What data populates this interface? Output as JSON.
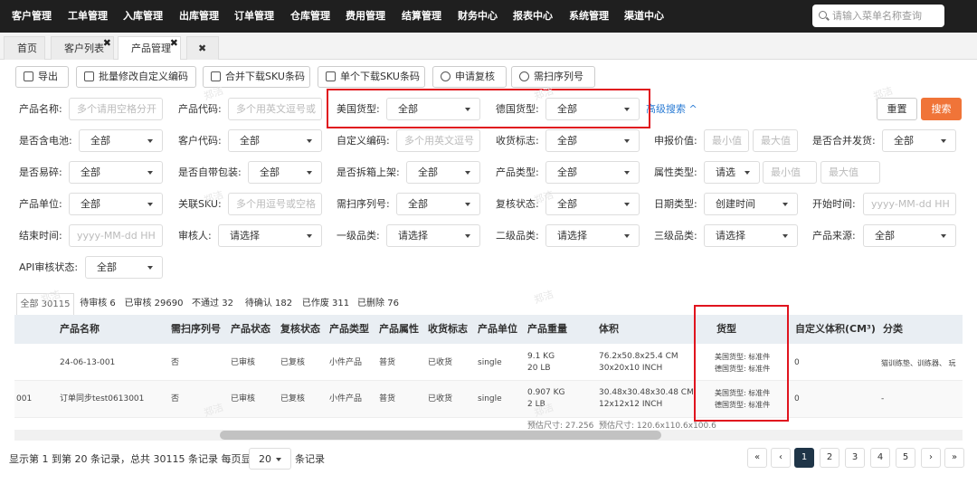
{
  "topnav": {
    "items": [
      "客户管理",
      "工单管理",
      "入库管理",
      "出库管理",
      "订单管理",
      "仓库管理",
      "费用管理",
      "结算管理",
      "财务中心",
      "报表中心",
      "系统管理",
      "渠道中心"
    ],
    "search_placeholder": "请输入菜单名称查询"
  },
  "tabs": {
    "home": "首页",
    "customer_list": "客户列表",
    "product_mgmt": "产品管理",
    "close_glyph": "✖"
  },
  "toolbar": {
    "export": "导出",
    "batch_edit": "批量修改自定义编码",
    "merge_download": "合并下载SKU条码",
    "single_download": "单个下载SKU条码",
    "apply_review": "申请复核",
    "need_serial": "需扫序列号"
  },
  "filters": {
    "product_name": {
      "label": "产品名称:",
      "placeholder": "多个请用空格分开"
    },
    "product_code": {
      "label": "产品代码:",
      "placeholder": "多个用英文逗号或"
    },
    "us_cargo": {
      "label": "美国货型:",
      "value": "全部"
    },
    "de_cargo": {
      "label": "德国货型:",
      "value": "全部"
    },
    "advanced": "高级搜索",
    "reset": "重置",
    "search": "搜索",
    "battery": {
      "label": "是否含电池:",
      "value": "全部"
    },
    "customer_code": {
      "label": "客户代码:",
      "value": "全部"
    },
    "custom_code": {
      "label": "自定义编码:",
      "placeholder": "多个用英文逗号"
    },
    "receive_flag": {
      "label": "收货标志:",
      "value": "全部"
    },
    "declared_value": {
      "label": "申报价值:",
      "min": "最小值",
      "max": "最大值"
    },
    "merge_ship": {
      "label": "是否合并发货:",
      "value": "全部"
    },
    "fragile": {
      "label": "是否易碎:",
      "value": "全部"
    },
    "own_pack": {
      "label": "是否自带包装:",
      "value": "全部"
    },
    "split_shelf": {
      "label": "是否拆箱上架:",
      "value": "全部"
    },
    "product_type": {
      "label": "产品类型:",
      "value": "全部"
    },
    "attr_type": {
      "label": "属性类型:",
      "value": "请选",
      "min": "最小值",
      "max": "最大值"
    },
    "unit": {
      "label": "产品单位:",
      "value": "全部"
    },
    "linked_sku": {
      "label": "关联SKU:",
      "placeholder": "多个用逗号或空格"
    },
    "need_serial": {
      "label": "需扫序列号:",
      "value": "全部"
    },
    "review_status": {
      "label": "复核状态:",
      "value": "全部"
    },
    "date_type": {
      "label": "日期类型:",
      "value": "创建时间"
    },
    "start_time": {
      "label": "开始时间:",
      "placeholder": "yyyy-MM-dd HH"
    },
    "end_time": {
      "label": "结束时间:",
      "placeholder": "yyyy-MM-dd HH"
    },
    "reviewer": {
      "label": "审核人:",
      "value": "请选择"
    },
    "cat1": {
      "label": "一级品类:",
      "value": "请选择"
    },
    "cat2": {
      "label": "二级品类:",
      "value": "请选择"
    },
    "cat3": {
      "label": "三级品类:",
      "value": "请选择"
    },
    "source": {
      "label": "产品来源:",
      "value": "全部"
    },
    "api_status": {
      "label": "API审核状态:",
      "value": "全部"
    }
  },
  "status_tabs": [
    "全部 30115",
    "待审核 6",
    "已审核 29690",
    "不通过 32",
    "待确认 182",
    "已作废 311",
    "已删除 76"
  ],
  "table": {
    "headers": [
      "产品名称",
      "需扫序列号",
      "产品状态",
      "复核状态",
      "产品类型",
      "产品属性",
      "收货标志",
      "产品单位",
      "产品重量",
      "体积",
      "货型",
      "自定义体积(CM³)",
      "分类"
    ],
    "rows": [
      {
        "code": "",
        "name": "24-06-13-001",
        "serial": "否",
        "status": "已审核",
        "review": "已复核",
        "type": "小件产品",
        "attr": "普货",
        "recv": "已收货",
        "unit": "single",
        "weight1": "9.1 KG",
        "weight2": "20 LB",
        "vol1": "76.2x50.8x25.4 CM",
        "vol2": "30x20x10 INCH",
        "cargo1": "美国货型: 标准件",
        "cargo2": "德国货型: 标准件",
        "custom_vol": "0",
        "category": "猫训练垫、训练器、 玩"
      },
      {
        "code": "001",
        "name": "订单同步test0613001",
        "serial": "否",
        "status": "已审核",
        "review": "已复核",
        "type": "小件产品",
        "attr": "普货",
        "recv": "已收货",
        "unit": "single",
        "weight1": "0.907 KG",
        "weight2": "2 LB",
        "vol1": "30.48x30.48x30.48 CM",
        "vol2": "12x12x12 INCH",
        "cargo1": "美国货型: 标准件",
        "cargo2": "德国货型: 标准件",
        "custom_vol": "0",
        "category": "-"
      }
    ],
    "partial_row": {
      "weight": "预估尺寸: 27.256",
      "vol": "预估尺寸: 120.6x110.6x100.6"
    }
  },
  "pagination": {
    "summary_prefix": "显示第 1 到第 20 条记录，总共 30115 条记录 每页显示",
    "page_size": "20",
    "summary_suffix": "条记录",
    "first": "«",
    "prev": "‹",
    "pages": [
      "1",
      "2",
      "3",
      "4",
      "5"
    ],
    "next": "›",
    "last": "»"
  },
  "watermark": "郑洁"
}
